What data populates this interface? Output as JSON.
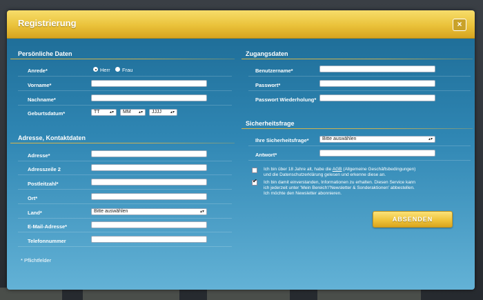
{
  "dialog": {
    "title": "Registrierung",
    "close_symbol": "×"
  },
  "personal": {
    "heading": "Persönliche Daten",
    "salutation_label": "Anrede*",
    "salutation_options": [
      "Herr",
      "Frau"
    ],
    "salutation_selected": "Herr",
    "first_name_label": "Vorname*",
    "last_name_label": "Nachname*",
    "birthdate_label": "Geburtsdatum*",
    "day_select": "TT",
    "month_select": "MM",
    "year_select": "JJJJ"
  },
  "address": {
    "heading": "Adresse, Kontaktdaten",
    "street_label": "Adresse*",
    "street2_label": "Adresszeile 2",
    "zip_label": "Postleitzahl*",
    "city_label": "Ort*",
    "country_label": "Land*",
    "country_select": "Bitte auswählen",
    "email_label": "E-Mail-Adresse*",
    "phone_label": "Telefonnummer"
  },
  "access": {
    "heading": "Zugangsdaten",
    "username_label": "Benutzername*",
    "password_label": "Passwort*",
    "password_repeat_label": "Passwort Wiederholung*"
  },
  "security": {
    "heading": "Sicherheitsfrage",
    "question_label": "Ihre Sicherheitsfrage*",
    "question_select": "Bitte auswählen",
    "answer_label": "Antwort*"
  },
  "consents": {
    "age_text_before": "Ich bin über 18 Jahre alt, habe die ",
    "age_link": "AGB",
    "age_text_after": " (Allgemeine Geschäftsbedingungen)",
    "age_text_line2": "und die Datenschutzerklärung gelesen und erkenne diese an.",
    "age_checked": false,
    "newsletter_line1": "Ich bin damit einverstanden, Informationen zu erhalten. Diesen Service kann",
    "newsletter_line2": "ich jederzeit unter 'Mein Bereich'/'Newsletter & Sonderaktionen' abbestellen.",
    "newsletter_line3": "Ich möchte den Newsletter abonnieren.",
    "newsletter_checked": true
  },
  "submit_label": "ABSENDEN",
  "footnote": "* Pflichtfelder",
  "colors": {
    "header_gold": "#eac23a",
    "panel_blue": "#2f86b3",
    "accent_line": "#d8b64a"
  }
}
